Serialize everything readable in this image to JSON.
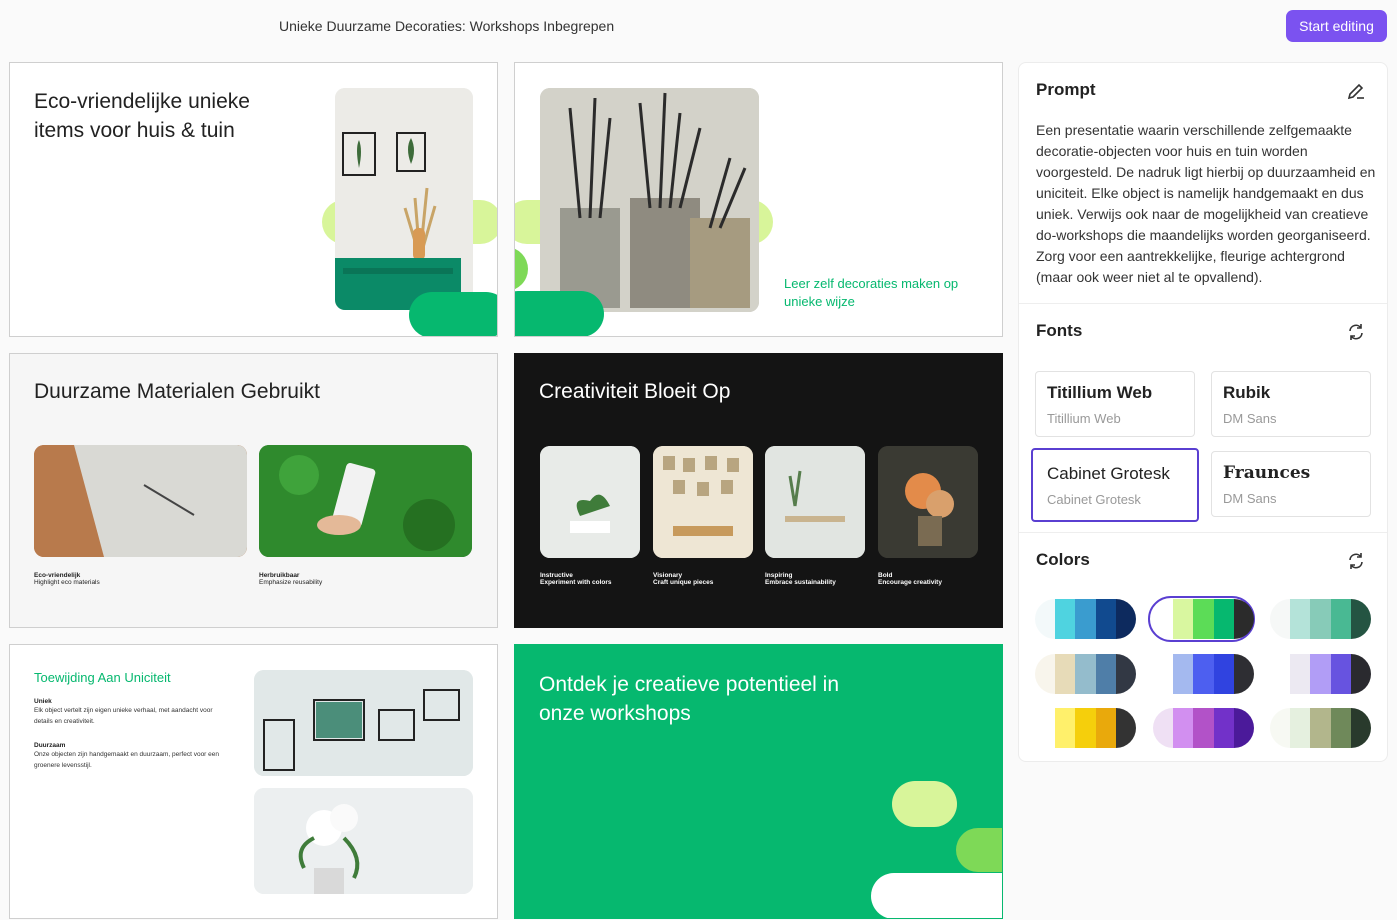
{
  "header": {
    "title": "Unieke Duurzame Decoraties: Workshops Inbegrepen",
    "start_label": "Start editing"
  },
  "slides": {
    "s1": {
      "title": "Eco-vriendelijke unieke items voor huis & tuin"
    },
    "s2": {
      "subtitle": "Leer zelf decoraties maken op unieke wijze"
    },
    "s3": {
      "title": "Duurzame Materialen Gebruikt",
      "items": [
        {
          "heading": "Eco-vriendelijk",
          "text": "Highlight eco materials"
        },
        {
          "heading": "Herbruikbaar",
          "text": "Emphasize reusability"
        }
      ]
    },
    "s4": {
      "title": "Creativiteit Bloeit Op",
      "items": [
        {
          "heading": "Instructive",
          "text": "Experiment with colors"
        },
        {
          "heading": "Visionary",
          "text": "Craft unique pieces"
        },
        {
          "heading": "Inspiring",
          "text": "Embrace sustainability"
        },
        {
          "heading": "Bold",
          "text": "Encourage creativity"
        }
      ]
    },
    "s5": {
      "title": "Toewijding Aan Uniciteit",
      "items": [
        {
          "heading": "Uniek",
          "text": "Elk object vertelt zijn eigen unieke verhaal, met aandacht voor details en creativiteit."
        },
        {
          "heading": "Duurzaam",
          "text": "Onze objecten zijn handgemaakt en duurzaam, perfect voor een groenere levensstijl."
        }
      ]
    },
    "s6": {
      "title": "Ontdek je creatieve potentieel in onze workshops"
    }
  },
  "panel": {
    "prompt_title": "Prompt",
    "prompt_text": "Een presentatie waarin verschillende zelfgemaakte decoratie-objecten voor huis en tuin worden voorgesteld. De nadruk ligt hierbij op duurzaamheid en uniciteit. Elke object is namelijk handgemaakt en dus uniek. Verwijs ook naar de mogelijkheid van creatieve do-workshops die maandelijks worden georganiseerd. Zorg voor een aantrekkelijke, fleurige achtergrond (maar ook weer niet al te opvallend).",
    "fonts_title": "Fonts",
    "fonts": [
      {
        "name": "Titillium Web",
        "sub": "Titillium Web"
      },
      {
        "name": "Rubik",
        "sub": "DM Sans"
      },
      {
        "name": "Cabinet Grotesk",
        "sub": "Cabinet Grotesk"
      },
      {
        "name": "Fraunces",
        "sub": "DM Sans"
      }
    ],
    "colors_title": "Colors",
    "palettes": [
      [
        "#f3f9fa",
        "#4fd3e0",
        "#3a9ccf",
        "#114a8f",
        "#0d2a5e"
      ],
      [
        "#ffffff",
        "#d9f7a0",
        "#5cdc57",
        "#06b86f",
        "#2b2b2b"
      ],
      [
        "#f6f8f7",
        "#b4e3d9",
        "#87cbb8",
        "#49b993",
        "#245442"
      ],
      [
        "#f8f5ec",
        "#e7dbb8",
        "#94bccc",
        "#4f7ea8",
        "#323844"
      ],
      [
        "#ffffff",
        "#a4b9ef",
        "#4d5ff0",
        "#3043e0",
        "#2e2e33"
      ],
      [
        "#ffffff",
        "#ece9f2",
        "#b19df6",
        "#6753e0",
        "#2a2a2f"
      ],
      [
        "#ffffff",
        "#fff06b",
        "#f5cf0c",
        "#e9a90c",
        "#333333"
      ],
      [
        "#efe0f4",
        "#d28ff0",
        "#b252c8",
        "#7231c9",
        "#4b1a9a"
      ],
      [
        "#f7f9f3",
        "#e5f0df",
        "#b2b68c",
        "#6f895a",
        "#293a2c"
      ]
    ],
    "accent": "#7b52f0",
    "brand_green": "#06b86f"
  }
}
